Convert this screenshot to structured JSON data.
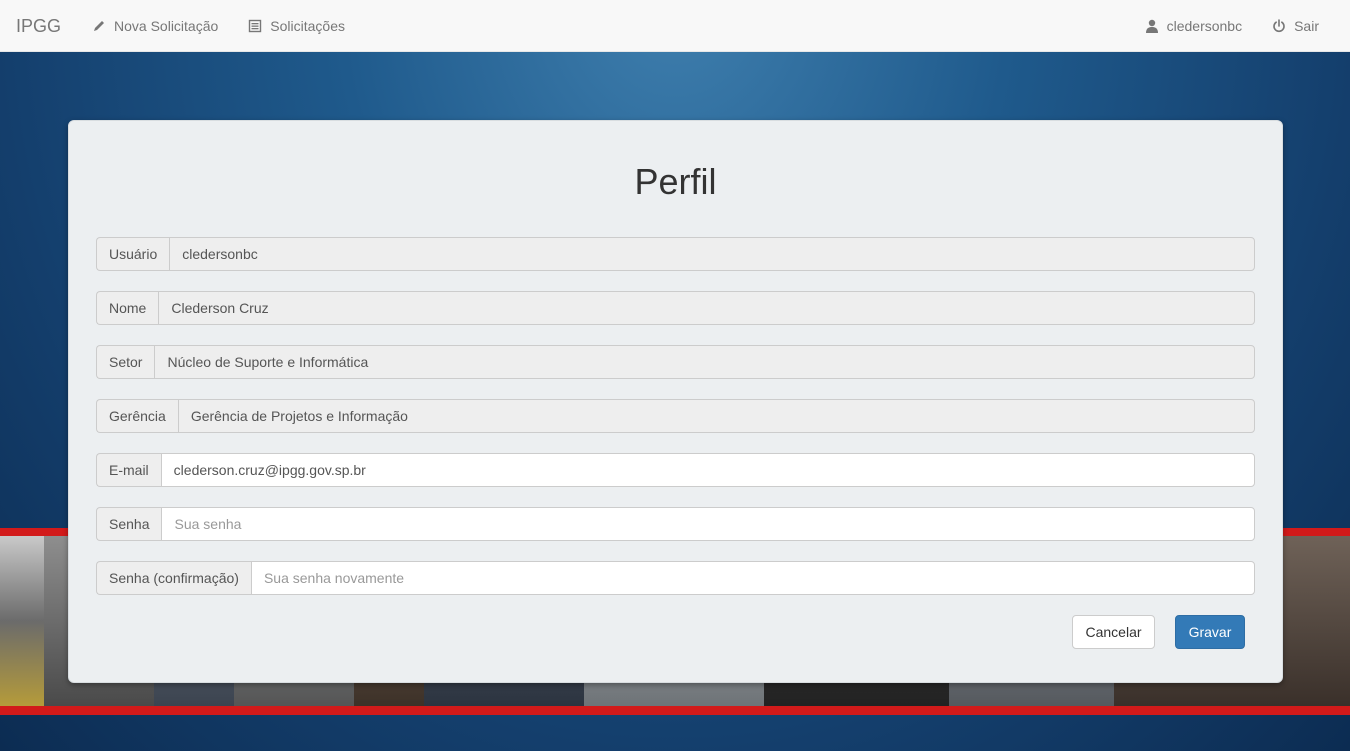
{
  "navbar": {
    "brand": "IPGG",
    "items": [
      {
        "label": "Nova Solicitação",
        "icon": "pencil-icon"
      },
      {
        "label": "Solicitações",
        "icon": "list-icon"
      }
    ],
    "right": [
      {
        "label": "cledersonbc",
        "icon": "user-icon"
      },
      {
        "label": "Sair",
        "icon": "power-icon"
      }
    ]
  },
  "form": {
    "title": "Perfil",
    "fields": [
      {
        "label": "Usuário",
        "value": "cledersonbc",
        "readonly": true
      },
      {
        "label": "Nome",
        "value": "Clederson Cruz",
        "readonly": true
      },
      {
        "label": "Setor",
        "value": "Núcleo de Suporte e Informática",
        "readonly": true
      },
      {
        "label": "Gerência",
        "value": "Gerência de Projetos e Informação",
        "readonly": true
      },
      {
        "label": "E-mail",
        "value": "clederson.cruz@ipgg.gov.sp.br",
        "readonly": false
      },
      {
        "label": "Senha",
        "value": "",
        "placeholder": "Sua senha",
        "readonly": false
      },
      {
        "label": "Senha (confirmação)",
        "value": "",
        "placeholder": "Sua senha novamente",
        "readonly": false
      }
    ],
    "cancel_label": "Cancelar",
    "save_label": "Gravar"
  },
  "colors": {
    "primary": "#337ab7",
    "band_red": "#d21a1a",
    "background_blue": "#1f5a8c"
  }
}
